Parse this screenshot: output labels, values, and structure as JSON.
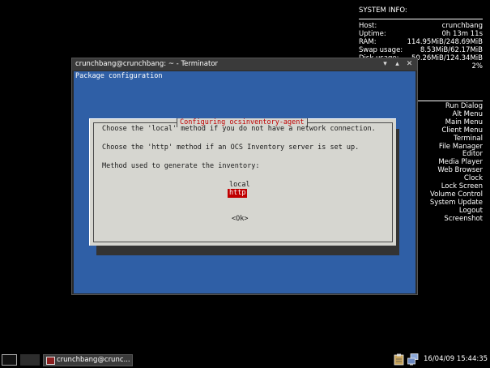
{
  "sysinfo": {
    "title": "SYSTEM INFO:",
    "rows": [
      {
        "label": "Host:",
        "value": "crunchbang"
      },
      {
        "label": "Uptime:",
        "value": "0h 13m 11s"
      },
      {
        "label": "RAM:",
        "value": "114.95MiB/248.69MiB"
      },
      {
        "label": "Swap usage:",
        "value": "8.53MiB/62.17MiB"
      },
      {
        "label": "Disk usage:",
        "value": "50.26MiB/124.34MiB"
      },
      {
        "label": "",
        "value": "2%"
      }
    ]
  },
  "shortcuts": [
    "Run Dialog",
    "Alt Menu",
    "Main Menu",
    "Client Menu",
    "Terminal",
    "File Manager",
    "Editor",
    "Media Player",
    "Web Browser",
    "Clock",
    "Lock Screen",
    "Volume Control",
    "System Update",
    "Logout",
    "Screenshot"
  ],
  "window": {
    "title": "crunchbang@crunchbang: ~ - Terminator",
    "btn_min": "▾",
    "btn_max": "▴",
    "btn_close": "✕"
  },
  "terminal": {
    "header": "Package configuration"
  },
  "dialog": {
    "title": "Configuring ocsinventory-agent",
    "line1": "Choose the 'local' method if you do not have a network connection.",
    "line2": "Choose the 'http' method if an OCS Inventory server is set up.",
    "line3": "Method used to generate the inventory:",
    "options": [
      {
        "label": "local",
        "selected": false
      },
      {
        "label": "http",
        "selected": true
      }
    ],
    "ok_label": "<Ok>"
  },
  "taskbar": {
    "task_label": "crunchbang@crunc...",
    "clock": "16/04/09 15:44:35",
    "tray_icons": [
      "clipboard-icon",
      "network-icon"
    ]
  }
}
